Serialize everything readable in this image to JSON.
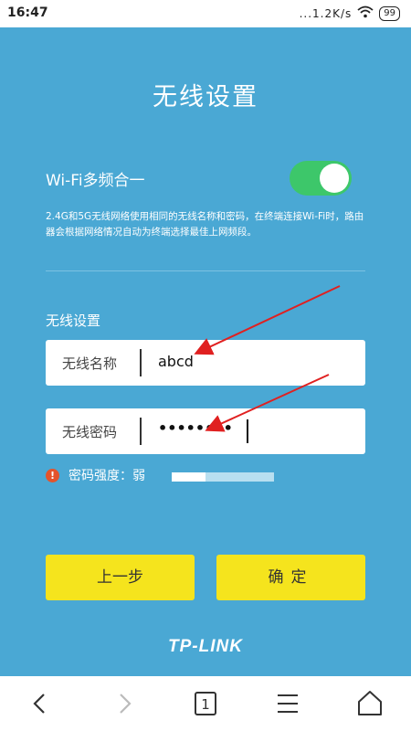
{
  "status_bar": {
    "time": "16:47",
    "network_speed": "...1.2K/s",
    "battery": "99"
  },
  "page": {
    "title": "无线设置"
  },
  "multiband": {
    "label": "Wi-Fi多频合一",
    "enabled": true,
    "description": "2.4G和5G无线网络使用相同的无线名称和密码，在终端连接Wi-Fi时，路由器会根据网络情况自动为终端选择最佳上网频段。"
  },
  "wireless": {
    "section_title": "无线设置",
    "name_label": "无线名称",
    "name_value": "abcd",
    "password_label": "无线密码",
    "password_value": "••••••••",
    "strength_label": "密码强度：弱",
    "strength_level": 0.33
  },
  "buttons": {
    "prev": "上一步",
    "confirm": "确定"
  },
  "brand": {
    "logo_text": "TP-LINK"
  },
  "nav": {
    "tab_count": "1"
  },
  "colors": {
    "background": "#4aa8d4",
    "button": "#f5e41d",
    "toggle_on": "#3dc76a",
    "warning": "#e4532b",
    "annotation_arrow": "#e02020"
  }
}
